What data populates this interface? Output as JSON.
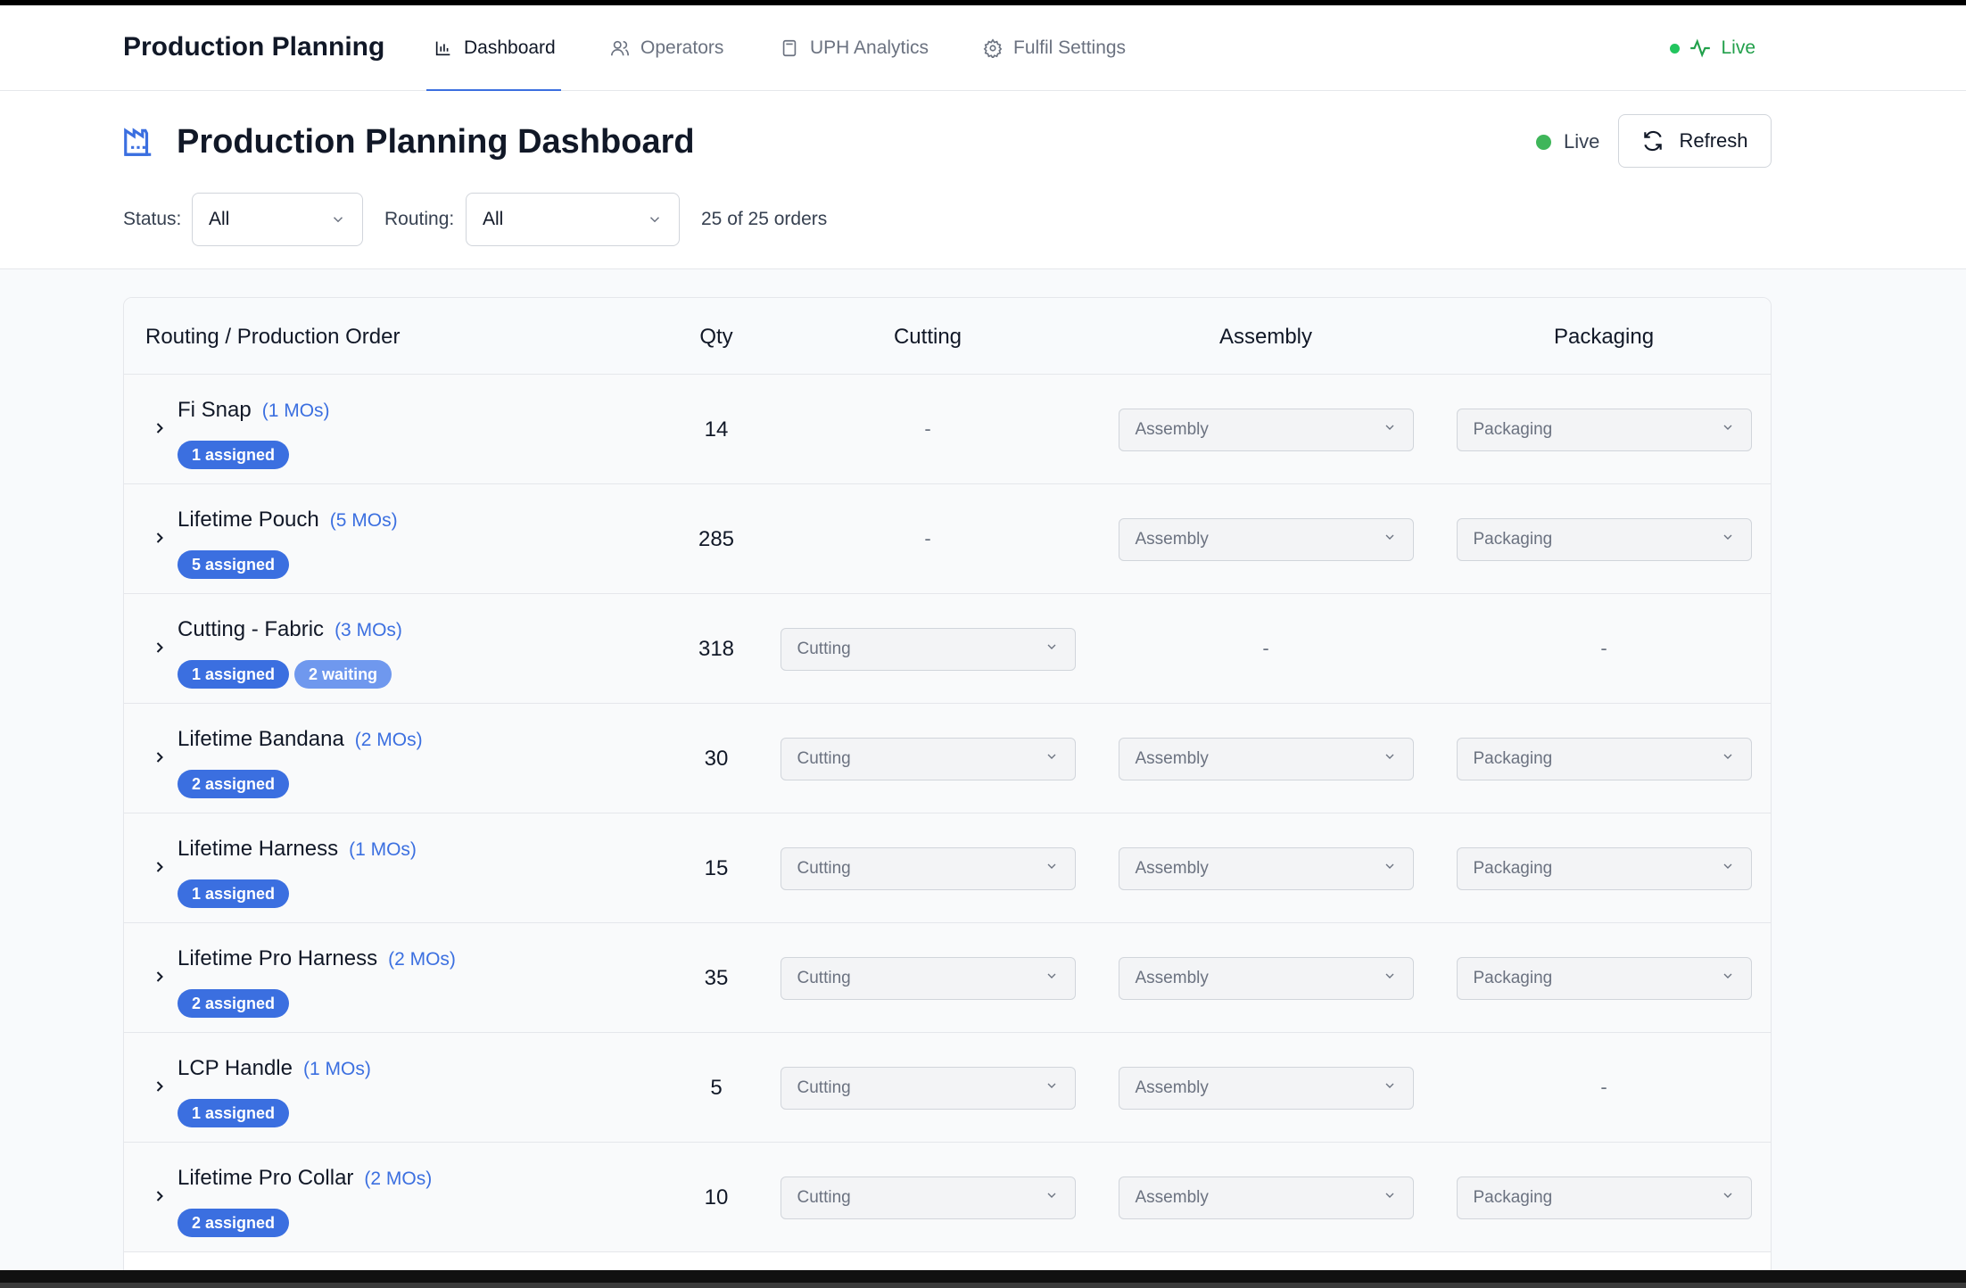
{
  "nav": {
    "brand": "Production Planning",
    "tabs": [
      {
        "label": "Dashboard",
        "icon": "bar-chart-icon",
        "active": true
      },
      {
        "label": "Operators",
        "icon": "users-icon",
        "active": false
      },
      {
        "label": "UPH Analytics",
        "icon": "calculator-icon",
        "active": false
      },
      {
        "label": "Fulfil Settings",
        "icon": "gear-icon",
        "active": false
      }
    ],
    "live_label": "Live"
  },
  "header": {
    "title": "Production Planning Dashboard",
    "live_label": "Live",
    "refresh_label": "Refresh",
    "status_label": "Status:",
    "status_value": "All",
    "routing_label": "Routing:",
    "routing_value": "All",
    "order_count": "25 of 25 orders"
  },
  "table": {
    "columns": [
      "Routing / Production Order",
      "Qty",
      "Cutting",
      "Assembly",
      "Packaging"
    ],
    "rows": [
      {
        "name": "Fi Snap",
        "mos": "(1 MOs)",
        "badges": [
          {
            "text": "1 assigned",
            "kind": "assigned"
          }
        ],
        "qty": "14",
        "cutting": null,
        "assembly": "Assembly",
        "packaging": "Packaging"
      },
      {
        "name": "Lifetime Pouch",
        "mos": "(5 MOs)",
        "badges": [
          {
            "text": "5 assigned",
            "kind": "assigned"
          }
        ],
        "qty": "285",
        "cutting": null,
        "assembly": "Assembly",
        "packaging": "Packaging"
      },
      {
        "name": "Cutting - Fabric",
        "mos": "(3 MOs)",
        "badges": [
          {
            "text": "1 assigned",
            "kind": "assigned"
          },
          {
            "text": "2 waiting",
            "kind": "waiting"
          }
        ],
        "qty": "318",
        "cutting": "Cutting",
        "assembly": null,
        "packaging": null
      },
      {
        "name": "Lifetime Bandana",
        "mos": "(2 MOs)",
        "badges": [
          {
            "text": "2 assigned",
            "kind": "assigned"
          }
        ],
        "qty": "30",
        "cutting": "Cutting",
        "assembly": "Assembly",
        "packaging": "Packaging"
      },
      {
        "name": "Lifetime Harness",
        "mos": "(1 MOs)",
        "badges": [
          {
            "text": "1 assigned",
            "kind": "assigned"
          }
        ],
        "qty": "15",
        "cutting": "Cutting",
        "assembly": "Assembly",
        "packaging": "Packaging"
      },
      {
        "name": "Lifetime Pro Harness",
        "mos": "(2 MOs)",
        "badges": [
          {
            "text": "2 assigned",
            "kind": "assigned"
          }
        ],
        "qty": "35",
        "cutting": "Cutting",
        "assembly": "Assembly",
        "packaging": "Packaging"
      },
      {
        "name": "LCP Handle",
        "mos": "(1 MOs)",
        "badges": [
          {
            "text": "1 assigned",
            "kind": "assigned"
          }
        ],
        "qty": "5",
        "cutting": "Cutting",
        "assembly": "Assembly",
        "packaging": null
      },
      {
        "name": "Lifetime Pro Collar",
        "mos": "(2 MOs)",
        "badges": [
          {
            "text": "2 assigned",
            "kind": "assigned"
          }
        ],
        "qty": "10",
        "cutting": "Cutting",
        "assembly": "Assembly",
        "packaging": "Packaging"
      }
    ],
    "empty_cell": "-"
  },
  "colors": {
    "accent": "#3b6fe0",
    "live": "#22a04b",
    "badge_waiting": "#6f98ee"
  }
}
